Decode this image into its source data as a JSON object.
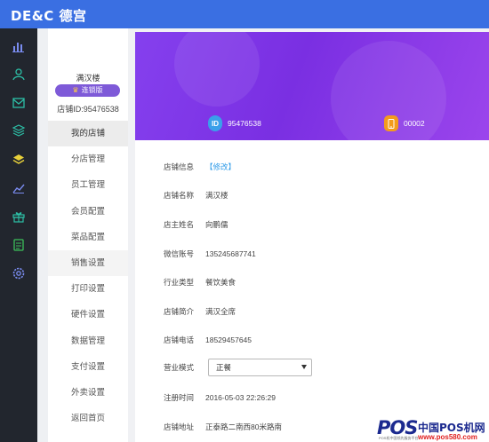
{
  "app": {
    "logo_text": "DE&C 德宫"
  },
  "rail": {
    "icons": [
      "bar-chart-icon",
      "user-icon",
      "mail-icon",
      "layers-icon",
      "stack-icon",
      "trend-icon",
      "gift-icon",
      "report-icon",
      "settings-icon"
    ],
    "colors": {
      "default": "#2dbfa6",
      "highlight": "#e8d03a",
      "bg": "#22262e"
    }
  },
  "sidebar": {
    "store_name": "满汉楼",
    "badge": "连锁版",
    "store_id": "店铺ID:95476538",
    "menu": [
      {
        "label": "我的店铺"
      },
      {
        "label": "分店管理"
      },
      {
        "label": "员工管理"
      },
      {
        "label": "会员配置"
      },
      {
        "label": "菜品配置"
      },
      {
        "label": "销售设置"
      },
      {
        "label": "打印设置"
      },
      {
        "label": "硬件设置"
      },
      {
        "label": "数据管理"
      },
      {
        "label": "支付设置"
      },
      {
        "label": "外卖设置"
      },
      {
        "label": "返回首页"
      }
    ]
  },
  "banner": {
    "id_icon": "ID",
    "id_value": "95476538",
    "phone_value": "00002",
    "colors": {
      "start": "#8540ee",
      "end": "#9b45ec"
    }
  },
  "info": {
    "rows": [
      {
        "label": "店铺信息",
        "value": "【修改】"
      },
      {
        "label": "店铺名称",
        "value": "满汉楼"
      },
      {
        "label": "店主姓名",
        "value": "向鹏儒"
      },
      {
        "label": "微信账号",
        "value": "135245687741"
      },
      {
        "label": "行业类型",
        "value": "餐饮美食"
      },
      {
        "label": "店铺简介",
        "value": "满汉全席"
      },
      {
        "label": "店铺电话",
        "value": "18529457645"
      },
      {
        "label": "营业模式",
        "value": "正餐"
      },
      {
        "label": "注册时间",
        "value": "2016-05-03 22:26:29"
      },
      {
        "label": "店铺地址",
        "value": "正泰路二南西80米路南"
      }
    ]
  },
  "watermark": {
    "brand": "POS",
    "cn": "中国POS机网",
    "tagline": "POS机中国领先服务平台",
    "url": "www.pos580.com"
  }
}
